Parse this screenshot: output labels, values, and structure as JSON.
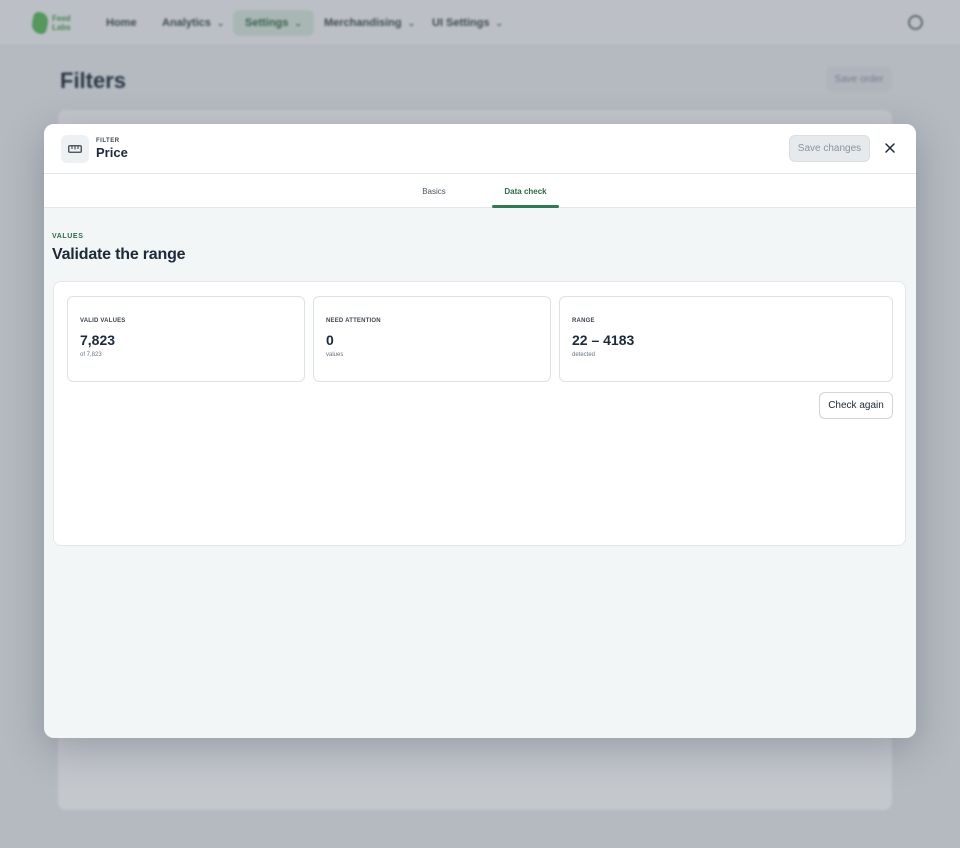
{
  "nav": {
    "logo_text": "Feed Labs",
    "items": [
      {
        "label": "Home",
        "chevron": false,
        "active": false
      },
      {
        "label": "Analytics",
        "chevron": true,
        "active": false
      },
      {
        "label": "Settings",
        "chevron": true,
        "active": true
      },
      {
        "label": "Merchandising",
        "chevron": true,
        "active": false
      },
      {
        "label": "UI Settings",
        "chevron": true,
        "active": false
      }
    ]
  },
  "background": {
    "page_title": "Filters",
    "save_order_label": "Save order"
  },
  "modal": {
    "kicker": "FILTER",
    "filter_name": "Price",
    "save_label": "Save changes",
    "tabs": [
      {
        "label": "Basics",
        "active": false
      },
      {
        "label": "Data check",
        "active": true
      }
    ],
    "section_kicker": "VALUES",
    "section_title": "Validate the range",
    "stats": [
      {
        "label": "VALID VALUES",
        "value": "7,823",
        "sub": "of 7,823"
      },
      {
        "label": "NEED ATTENTION",
        "value": "0",
        "sub": "values"
      },
      {
        "label": "RANGE",
        "value": "22 – 4183",
        "sub": "detected"
      }
    ],
    "check_again_label": "Check again"
  },
  "colors": {
    "accent": "#2f7a50",
    "overlay": "#465060"
  }
}
